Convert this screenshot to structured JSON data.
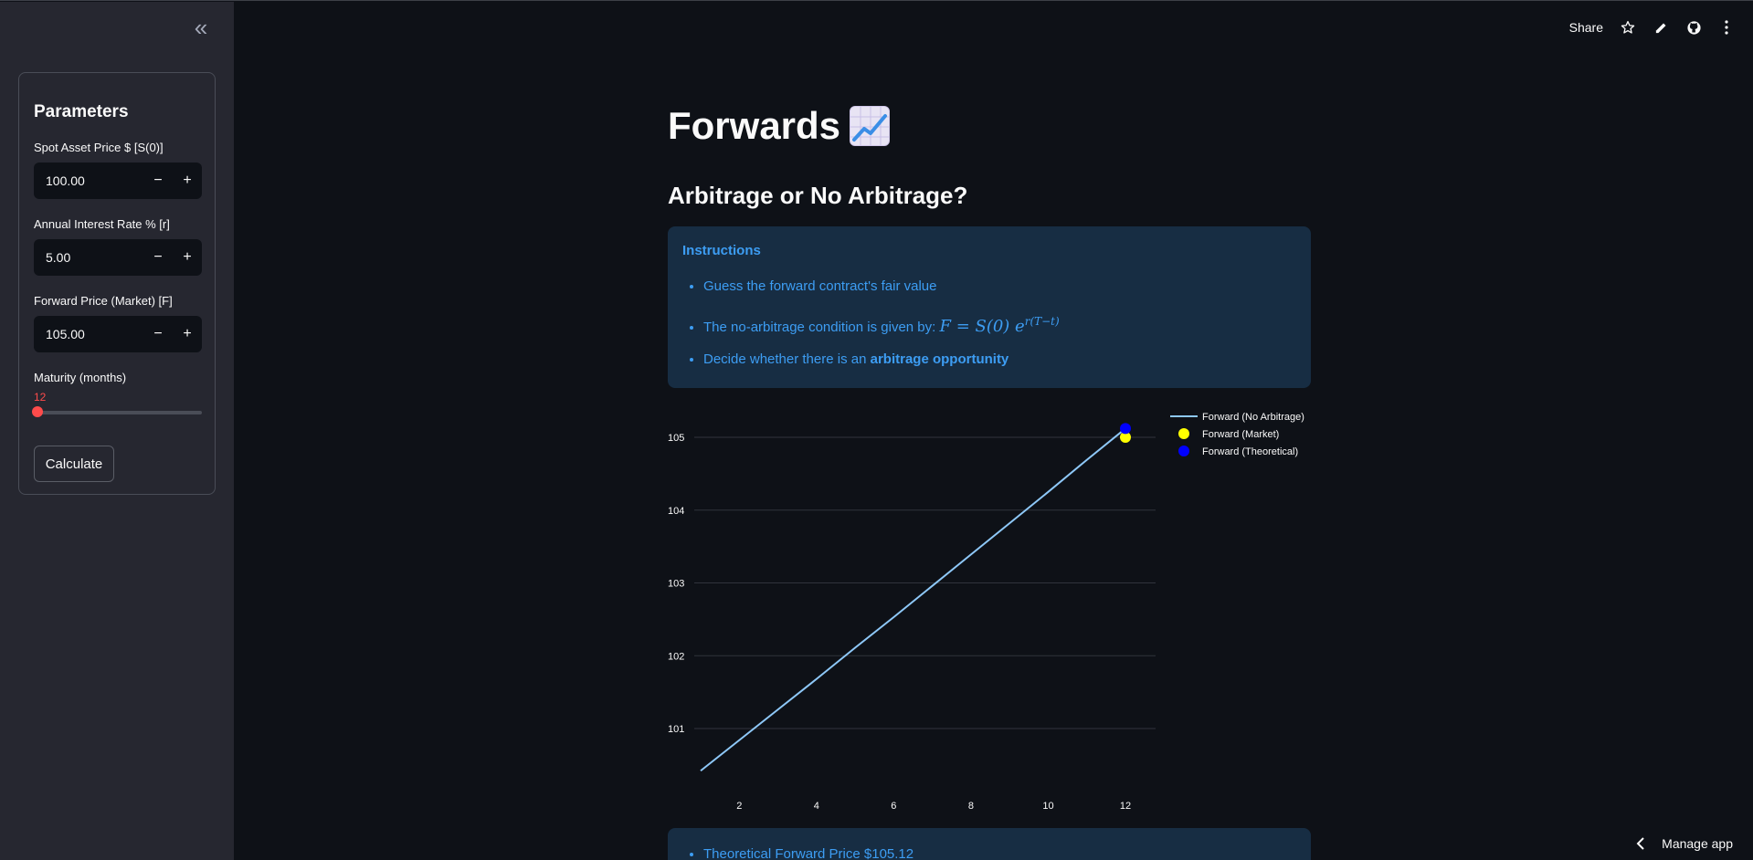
{
  "sidebar": {
    "collapse_icon": "«",
    "title": "Parameters",
    "spot_label": "Spot Asset Price $ [S(0)]",
    "spot_value": "100.00",
    "rate_label": "Annual Interest Rate % [r]",
    "rate_value": "5.00",
    "forward_label": "Forward Price (Market) [F]",
    "forward_value": "105.00",
    "maturity_label": "Maturity (months)",
    "maturity_value": "12",
    "maturity_fraction": 0,
    "calculate_label": "Calculate",
    "minus": "−",
    "plus": "+"
  },
  "toolbar": {
    "share_label": "Share",
    "icons": [
      "star-icon",
      "pencil-icon",
      "github-icon",
      "more-vert-icon"
    ]
  },
  "main": {
    "title": "Forwards",
    "emoji_icon": "chart-increasing-icon",
    "subtitle": "Arbitrage or No Arbitrage?",
    "instructions_title": "Instructions",
    "bullet_1": "Guess the forward contract's fair value",
    "bullet_2_prefix": "The no-arbitrage condition is given by: ",
    "formula_main": "F = S(0) e",
    "formula_exp": "r(T−t)",
    "bullet_3_prefix": "Decide whether there is an ",
    "bullet_3_bold": "arbitrage opportunity",
    "result_1": "Theoretical Forward Price $105.12"
  },
  "chart_data": {
    "type": "line",
    "x": [
      1,
      2,
      3,
      4,
      5,
      6,
      7,
      8,
      9,
      10,
      11,
      12
    ],
    "series": [
      {
        "name": "Forward (No Arbitrage)",
        "type": "line",
        "color": "#8ec8f8",
        "values": [
          100.42,
          100.84,
          101.26,
          101.68,
          102.11,
          102.53,
          102.96,
          103.39,
          103.82,
          104.25,
          104.69,
          105.12
        ]
      },
      {
        "name": "Forward (Market)",
        "type": "scatter",
        "color": "#ffff00",
        "x": [
          12
        ],
        "values": [
          105.0
        ]
      },
      {
        "name": "Forward (Theoretical)",
        "type": "scatter",
        "color": "#0000ff",
        "x": [
          12
        ],
        "values": [
          105.12
        ]
      }
    ],
    "x_ticks": [
      2,
      4,
      6,
      8,
      10,
      12
    ],
    "y_ticks": [
      101,
      102,
      103,
      104,
      105
    ],
    "xlim": [
      1,
      12
    ],
    "ylim": [
      100.42,
      105.12
    ],
    "grid": "horizontal",
    "legend_position": "top-right",
    "title": "",
    "xlabel": "",
    "ylabel": ""
  },
  "footer": {
    "manage_label": "Manage app"
  }
}
